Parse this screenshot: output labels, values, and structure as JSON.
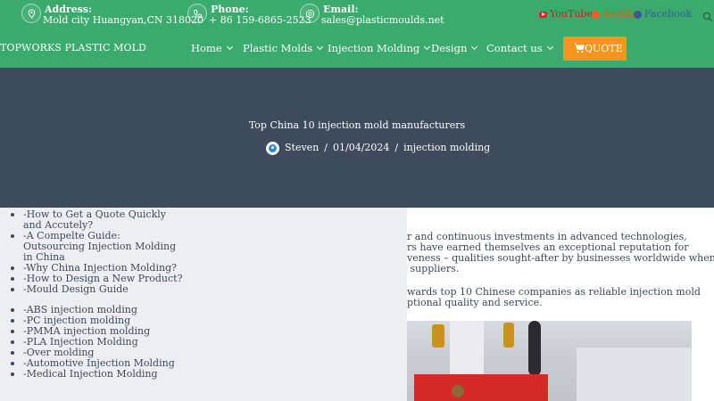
{
  "topbar": {
    "address": {
      "label": "Address:",
      "value": "Mold city Huangyan,CN 318020",
      "icon": "location-pin-icon"
    },
    "phone": {
      "label": "Phone:",
      "value": "+ 86 159-6865-2523",
      "icon": "phone-icon"
    },
    "email": {
      "label": "Email:",
      "value": "sales@plasticmoulds.net",
      "icon": "at-sign-icon"
    },
    "social": {
      "youtube": "YouTube",
      "reddit": "Reddit",
      "facebook": "Facebook"
    }
  },
  "nav": {
    "logo": "TOPWORKS PLASTIC MOLD",
    "items": [
      {
        "label": "Home"
      },
      {
        "label": "Plastic Molds"
      },
      {
        "label": "Injection Molding"
      },
      {
        "label": "Design"
      },
      {
        "label": "Contact us"
      }
    ],
    "quote": "QUOTE"
  },
  "hero": {
    "title": "Top China 10 injection mold manufacturers",
    "author": "Steven",
    "date": "01/04/2024",
    "category": "injection molding",
    "separator": "/"
  },
  "sidebar": {
    "guides": [
      "-How to Get a Quote Quickly and Accutely?",
      "-A Compelte Guide: Outsourcing Injection Molding in China",
      "-Why China Injection Molding?",
      "-How to Design a New Product?",
      "-Mould Design Guide"
    ],
    "materials": [
      "-ABS injection molding",
      "-PC injection molding",
      "-PMMA injection molding",
      "-PLA Injection Molding",
      "-Over molding",
      "-Automotive Injection Molding",
      "-Medical Injection Molding"
    ]
  },
  "article": {
    "p1_lines": [
      "r and continuous investments in advanced technologies,",
      "rs have earned themselves an exceptional reputation for",
      "veness – qualities sought-after by businesses worldwide when",
      " suppliers."
    ],
    "p2_lines": [
      "wards top 10 Chinese companies as reliable injection mold",
      "ptional quality and service."
    ]
  },
  "colors": {
    "topbar": "#3aab6c",
    "hero": "#3d4b5c",
    "quote": "#f7941d",
    "sidebar": "#eceef2"
  }
}
